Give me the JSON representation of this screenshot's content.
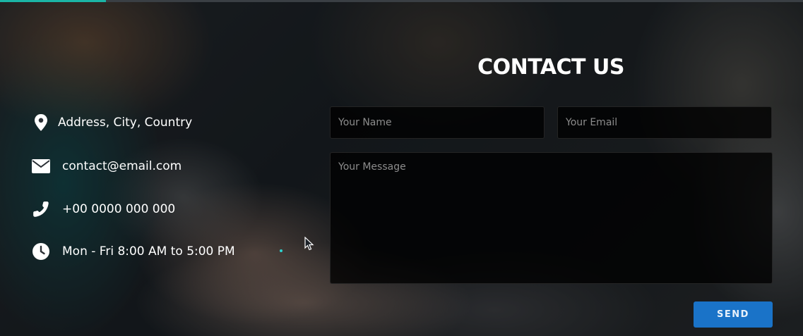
{
  "contact": {
    "title": "CONTACT US",
    "info": [
      {
        "icon": "map-pin-icon",
        "text": "Address, City, Country"
      },
      {
        "icon": "envelope-icon",
        "text": "contact@email.com"
      },
      {
        "icon": "phone-icon",
        "text": "+00 0000 000 000"
      },
      {
        "icon": "clock-icon",
        "text": "Mon - Fri 8:00 AM to 5:00 PM"
      }
    ],
    "form": {
      "name_placeholder": "Your Name",
      "email_placeholder": "Your Email",
      "message_placeholder": "Your Message",
      "send_label": "SEND"
    }
  },
  "colors": {
    "accent": "#1bb5a6",
    "button": "#1a73c8",
    "field_bg": "#000000"
  }
}
